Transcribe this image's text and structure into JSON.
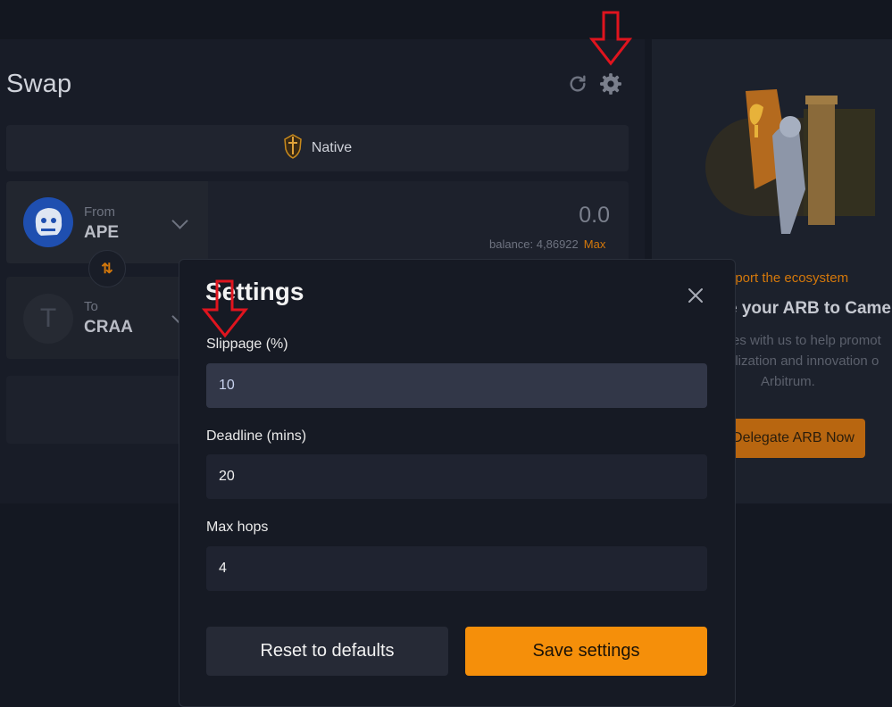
{
  "swap": {
    "title": "Swap",
    "mode_label": "Native",
    "from": {
      "label": "From",
      "token": "APE",
      "amount": "0.0",
      "balance_label": "balance: 4,86922",
      "max_label": "Max"
    },
    "to": {
      "label": "To",
      "token": "CRAA"
    },
    "switch_icon": "swap-vertical-icon"
  },
  "promo": {
    "support_text": "pport the ecosystem",
    "title": "e your ARB to Camel",
    "description": [
      "es with us to help promot",
      "ilization and innovation o",
      "Arbitrum."
    ],
    "button_label": "Delegate ARB Now"
  },
  "settings": {
    "title": "Settings",
    "slippage": {
      "label": "Slippage (%)",
      "value": "10"
    },
    "deadline": {
      "label": "Deadline (mins)",
      "value": "20"
    },
    "max_hops": {
      "label": "Max hops",
      "value": "4"
    },
    "reset_label": "Reset to defaults",
    "save_label": "Save settings"
  },
  "colors": {
    "accent": "#f58f0a",
    "annotation": "#e0141e",
    "background": "#141822"
  }
}
